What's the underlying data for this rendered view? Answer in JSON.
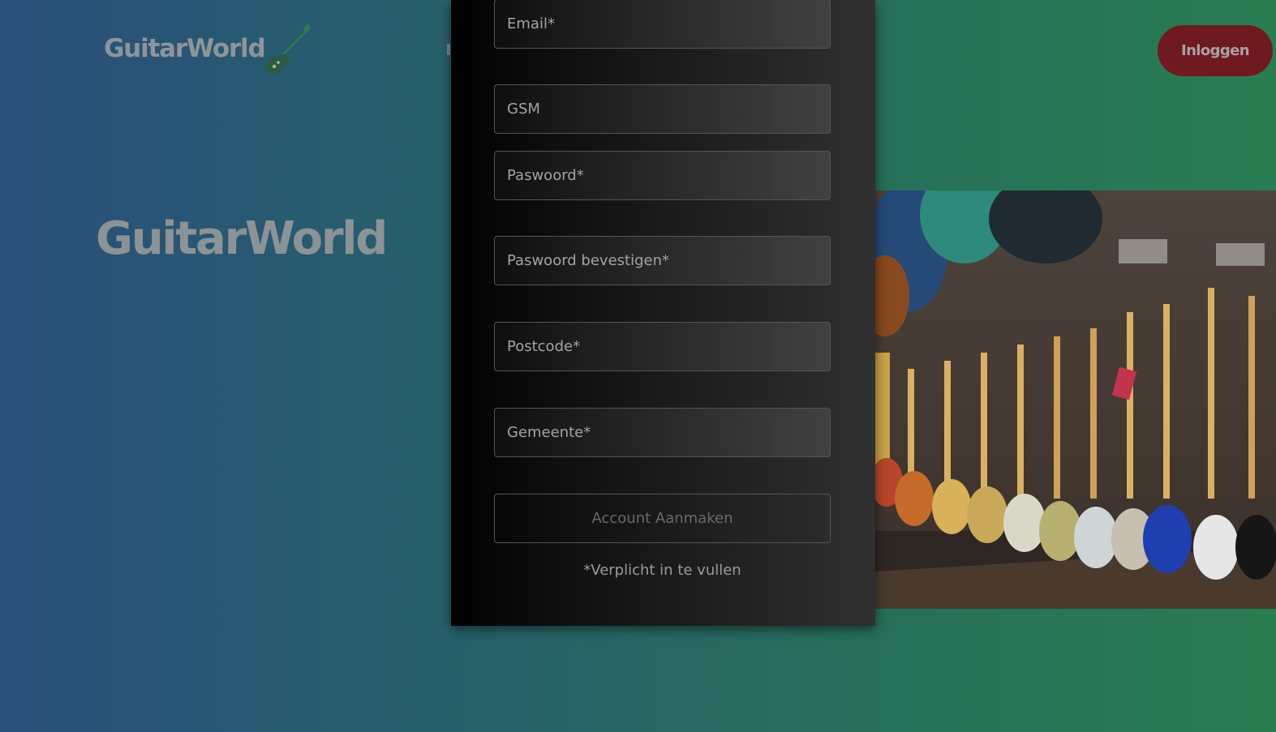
{
  "colors": {
    "background_left": "#2a4f7a",
    "background_right": "#2a7c52",
    "login_button": "#6e1a20",
    "modal_dark": "#010101",
    "modal_light": "#303030"
  },
  "header": {
    "logo_text": "GuitarWorld",
    "logo_icon": "electric-guitar-icon",
    "login_label": "Inloggen"
  },
  "hero": {
    "title": "GuitarWorld",
    "photo": "guitar-store-wall-photo"
  },
  "register_form": {
    "email_placeholder": "Email*",
    "gsm_placeholder": "GSM",
    "password_placeholder": "Paswoord*",
    "password_confirm_placeholder": "Paswoord bevestigen*",
    "postcode_placeholder": "Postcode*",
    "municipality_placeholder": "Gemeente*",
    "submit_label": "Account Aanmaken",
    "required_note": "*Verplicht in te vullen"
  }
}
